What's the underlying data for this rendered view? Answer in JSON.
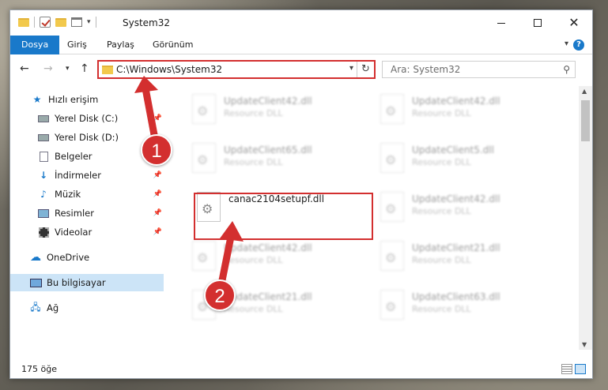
{
  "window": {
    "title": "System32"
  },
  "ribbon": {
    "tabs": [
      "Dosya",
      "Giriş",
      "Paylaş",
      "Görünüm"
    ],
    "help_label": "?"
  },
  "address": {
    "path": "C:\\Windows\\System32"
  },
  "search": {
    "placeholder": "Ara: System32"
  },
  "sidebar": {
    "items": [
      {
        "label": "Hızlı erişim",
        "icon": "star-icon"
      },
      {
        "label": "Yerel Disk (C:)",
        "icon": "drive-icon"
      },
      {
        "label": "Yerel Disk (D:)",
        "icon": "drive-icon"
      },
      {
        "label": "Belgeler",
        "icon": "document-icon"
      },
      {
        "label": "İndirmeler",
        "icon": "download-icon"
      },
      {
        "label": "Müzik",
        "icon": "music-icon"
      },
      {
        "label": "Resimler",
        "icon": "pictures-icon"
      },
      {
        "label": "Videolar",
        "icon": "video-icon"
      },
      {
        "label": "OneDrive",
        "icon": "cloud-icon"
      },
      {
        "label": "Bu bilgisayar",
        "icon": "computer-icon"
      },
      {
        "label": "Ağ",
        "icon": "network-icon"
      }
    ]
  },
  "files": [
    {
      "name": "UpdateClient42.dll",
      "desc": "Resource DLL"
    },
    {
      "name": "UpdateClient42.dll",
      "desc": "Resource DLL"
    },
    {
      "name": "UpdateClient65.dll",
      "desc": "Resource DLL"
    },
    {
      "name": "UpdateClient5.dll",
      "desc": "Resource DLL"
    },
    {
      "name": "canac2104setupf.dll",
      "desc": ""
    },
    {
      "name": "UpdateClient42.dll",
      "desc": "Resource DLL"
    },
    {
      "name": "UpdateClient42.dll",
      "desc": "Resource DLL"
    },
    {
      "name": "UpdateClient21.dll",
      "desc": "Resource DLL"
    },
    {
      "name": "UpdateClient21.dll",
      "desc": "Resource DLL"
    },
    {
      "name": "UpdateClient63.dll",
      "desc": "Resource DLL"
    }
  ],
  "status": {
    "count": "175 öğe"
  },
  "annotations": {
    "step1": "1",
    "step2": "2"
  },
  "colors": {
    "accent": "#1979ca",
    "highlight": "#d32f2f"
  }
}
